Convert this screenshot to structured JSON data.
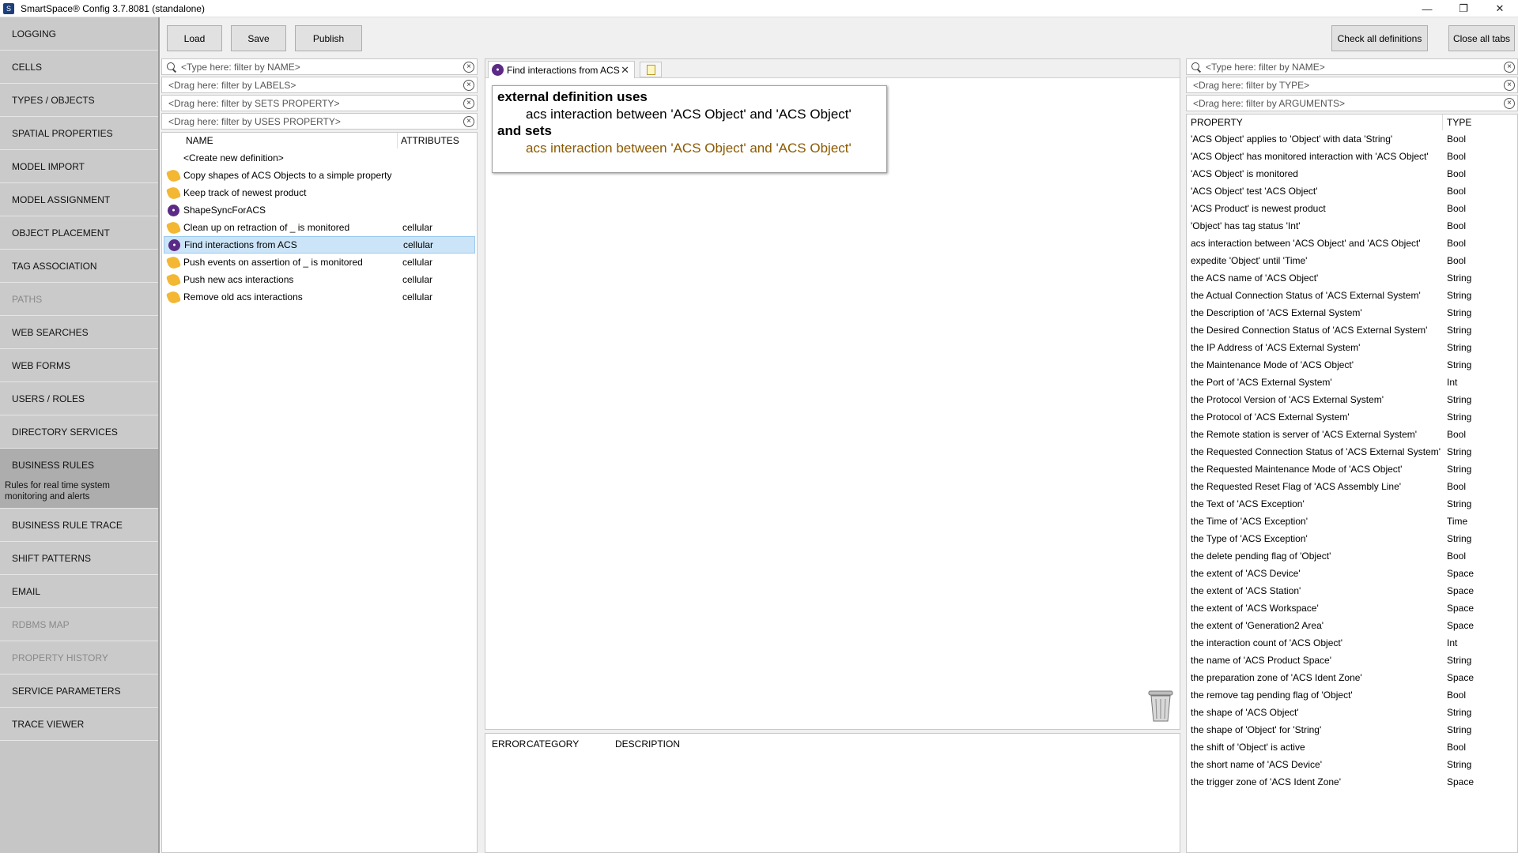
{
  "window": {
    "title": "SmartSpace® Config 3.7.8081 (standalone)",
    "min": "—",
    "max": "❐",
    "close": "✕"
  },
  "nav": [
    {
      "label": "LOGGING",
      "state": "normal"
    },
    {
      "label": "CELLS",
      "state": "normal"
    },
    {
      "label": "TYPES / OBJECTS",
      "state": "normal"
    },
    {
      "label": "SPATIAL PROPERTIES",
      "state": "normal"
    },
    {
      "label": "MODEL IMPORT",
      "state": "normal"
    },
    {
      "label": "MODEL ASSIGNMENT",
      "state": "normal"
    },
    {
      "label": "OBJECT PLACEMENT",
      "state": "normal"
    },
    {
      "label": "TAG ASSOCIATION",
      "state": "normal"
    },
    {
      "label": "PATHS",
      "state": "disabled"
    },
    {
      "label": "WEB SEARCHES",
      "state": "normal"
    },
    {
      "label": "WEB FORMS",
      "state": "normal"
    },
    {
      "label": "USERS / ROLES",
      "state": "normal"
    },
    {
      "label": "DIRECTORY SERVICES",
      "state": "normal"
    },
    {
      "label": "BUSINESS RULES",
      "state": "active",
      "description": "Rules for real time system monitoring and alerts"
    },
    {
      "label": "BUSINESS RULE TRACE",
      "state": "normal"
    },
    {
      "label": "SHIFT PATTERNS",
      "state": "normal"
    },
    {
      "label": "EMAIL",
      "state": "normal"
    },
    {
      "label": "RDBMS MAP",
      "state": "disabled"
    },
    {
      "label": "PROPERTY HISTORY",
      "state": "disabled"
    },
    {
      "label": "SERVICE PARAMETERS",
      "state": "normal"
    },
    {
      "label": "TRACE VIEWER",
      "state": "normal"
    }
  ],
  "toolbar": {
    "load": "Load",
    "save": "Save",
    "publish": "Publish",
    "check_all": "Check all definitions",
    "close_all": "Close all tabs"
  },
  "filters": {
    "name": "<Type here: filter by NAME>",
    "labels": "<Drag here: filter by LABELS>",
    "sets": "<Drag here: filter by SETS PROPERTY>",
    "uses": "<Drag here: filter by USES PROPERTY>"
  },
  "defs_list": {
    "col_name": "NAME",
    "col_attributes": "ATTRIBUTES",
    "create_new": "<Create new definition>",
    "rows": [
      {
        "name": "Copy shapes of ACS Objects to a simple property",
        "attr": "",
        "icon": "rule-icon"
      },
      {
        "name": "Keep track of newest product",
        "attr": "",
        "icon": "rule-icon"
      },
      {
        "name": "ShapeSyncForACS",
        "attr": "",
        "icon": "sync-icon"
      },
      {
        "name": "Clean up on retraction of _ is monitored",
        "attr": "cellular",
        "icon": "rule-icon"
      },
      {
        "name": "Find interactions from ACS",
        "attr": "cellular",
        "icon": "sync-icon",
        "selected": true
      },
      {
        "name": "Push events on assertion of _ is monitored",
        "attr": "cellular",
        "icon": "rule-icon"
      },
      {
        "name": "Push new acs interactions",
        "attr": "cellular",
        "icon": "rule-icon"
      },
      {
        "name": "Remove old acs interactions",
        "attr": "cellular",
        "icon": "rule-icon"
      }
    ]
  },
  "editor": {
    "tab_label": "Find interactions from ACS",
    "tab_close": "✕",
    "kw_uses": "external definition uses",
    "uses_line": "acs interaction between 'ACS Object' and 'ACS Object'",
    "kw_sets": "and sets",
    "sets_line": "acs interaction between 'ACS Object' and 'ACS Object'"
  },
  "errors": {
    "col_error": "ERROR",
    "col_category": "CATEGORY",
    "col_description": "DESCRIPTION"
  },
  "props_filters": {
    "name": "<Type here: filter by NAME>",
    "type": "<Drag here: filter by TYPE>",
    "args": "<Drag here: filter by ARGUMENTS>"
  },
  "props": {
    "col_property": "PROPERTY",
    "col_type": "TYPE",
    "rows": [
      {
        "name": "'ACS Object' applies to 'Object' with data 'String'",
        "type": "Bool"
      },
      {
        "name": "'ACS Object' has monitored interaction with 'ACS Object'",
        "type": "Bool"
      },
      {
        "name": "'ACS Object' is monitored",
        "type": "Bool"
      },
      {
        "name": "'ACS Object' test 'ACS Object'",
        "type": "Bool"
      },
      {
        "name": "'ACS Product' is newest product",
        "type": "Bool"
      },
      {
        "name": "'Object' has tag status 'Int'",
        "type": "Bool"
      },
      {
        "name": "acs interaction between 'ACS Object' and 'ACS Object'",
        "type": "Bool"
      },
      {
        "name": "expedite 'Object' until 'Time'",
        "type": "Bool"
      },
      {
        "name": "the ACS name of 'ACS Object'",
        "type": "String"
      },
      {
        "name": "the Actual Connection Status of 'ACS External System'",
        "type": "String"
      },
      {
        "name": "the Description of 'ACS External System'",
        "type": "String"
      },
      {
        "name": "the Desired Connection Status of 'ACS External System'",
        "type": "String"
      },
      {
        "name": "the IP Address of 'ACS External System'",
        "type": "String"
      },
      {
        "name": "the Maintenance Mode of 'ACS Object'",
        "type": "String"
      },
      {
        "name": "the Port of 'ACS External System'",
        "type": "Int"
      },
      {
        "name": "the Protocol Version of 'ACS External System'",
        "type": "String"
      },
      {
        "name": "the Protocol of 'ACS External System'",
        "type": "String"
      },
      {
        "name": "the Remote station is server of 'ACS External System'",
        "type": "Bool"
      },
      {
        "name": "the Requested Connection Status of 'ACS External System'",
        "type": "String"
      },
      {
        "name": "the Requested Maintenance Mode of 'ACS Object'",
        "type": "String"
      },
      {
        "name": "the Requested Reset Flag of 'ACS Assembly Line'",
        "type": "Bool"
      },
      {
        "name": "the Text of 'ACS Exception'",
        "type": "String"
      },
      {
        "name": "the Time of 'ACS Exception'",
        "type": "Time"
      },
      {
        "name": "the Type of 'ACS Exception'",
        "type": "String"
      },
      {
        "name": "the delete pending flag of 'Object'",
        "type": "Bool"
      },
      {
        "name": "the extent of 'ACS Device'",
        "type": "Space"
      },
      {
        "name": "the extent of 'ACS Station'",
        "type": "Space"
      },
      {
        "name": "the extent of 'ACS Workspace'",
        "type": "Space"
      },
      {
        "name": "the extent of 'Generation2 Area'",
        "type": "Space"
      },
      {
        "name": "the interaction count of 'ACS Object'",
        "type": "Int"
      },
      {
        "name": "the name of 'ACS Product Space'",
        "type": "String"
      },
      {
        "name": "the preparation zone of 'ACS Ident Zone'",
        "type": "Space"
      },
      {
        "name": "the remove tag pending flag of 'Object'",
        "type": "Bool"
      },
      {
        "name": "the shape of 'ACS Object'",
        "type": "String"
      },
      {
        "name": "the shape of 'Object' for 'String'",
        "type": "String"
      },
      {
        "name": "the shift of 'Object' is active",
        "type": "Bool"
      },
      {
        "name": "the short name of 'ACS Device'",
        "type": "String"
      },
      {
        "name": "the trigger zone of 'ACS Ident Zone'",
        "type": "Space"
      }
    ]
  }
}
